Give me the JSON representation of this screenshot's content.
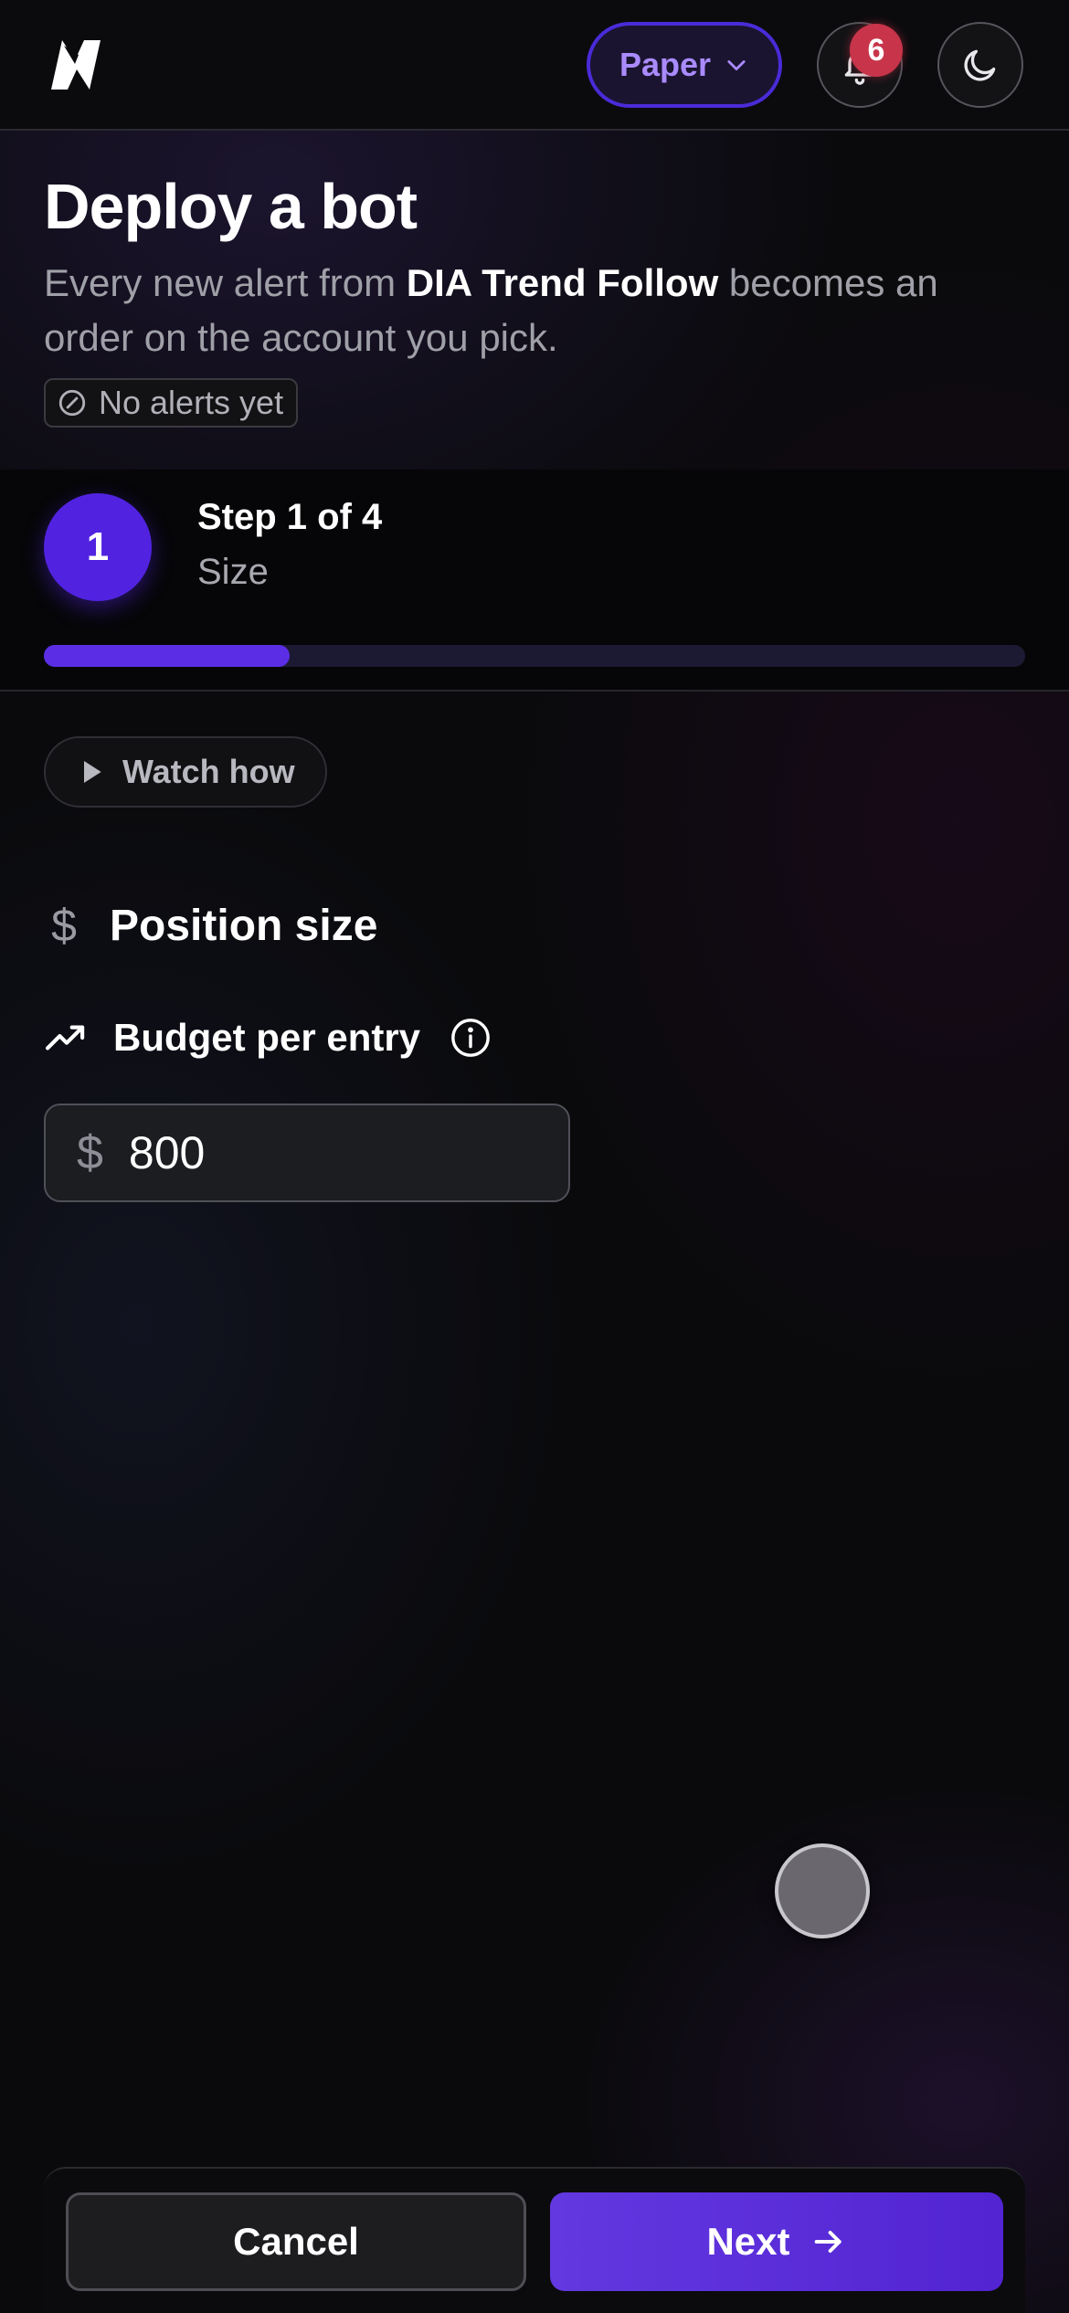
{
  "header": {
    "mode_label": "Paper",
    "notification_count": "6"
  },
  "page": {
    "title": "Deploy a bot",
    "subtitle_prefix": "Every new alert from ",
    "strategy_name": "DIA Trend Follow",
    "subtitle_suffix": " becomes an order on the account you pick.",
    "alerts_chip": "No alerts yet"
  },
  "stepper": {
    "step_number": "1",
    "step_label": "Step 1 of 4",
    "step_name": "Size",
    "progress_fraction": 0.25
  },
  "watch": {
    "label": "Watch how"
  },
  "position": {
    "section_title": "Position size",
    "budget_label": "Budget per entry",
    "currency_symbol": "$",
    "budget_value": "800"
  },
  "footer": {
    "cancel_label": "Cancel",
    "next_label": "Next"
  },
  "colors": {
    "accent": "#5123e0",
    "badge": "#c8344a",
    "mode_text": "#a98bff"
  }
}
